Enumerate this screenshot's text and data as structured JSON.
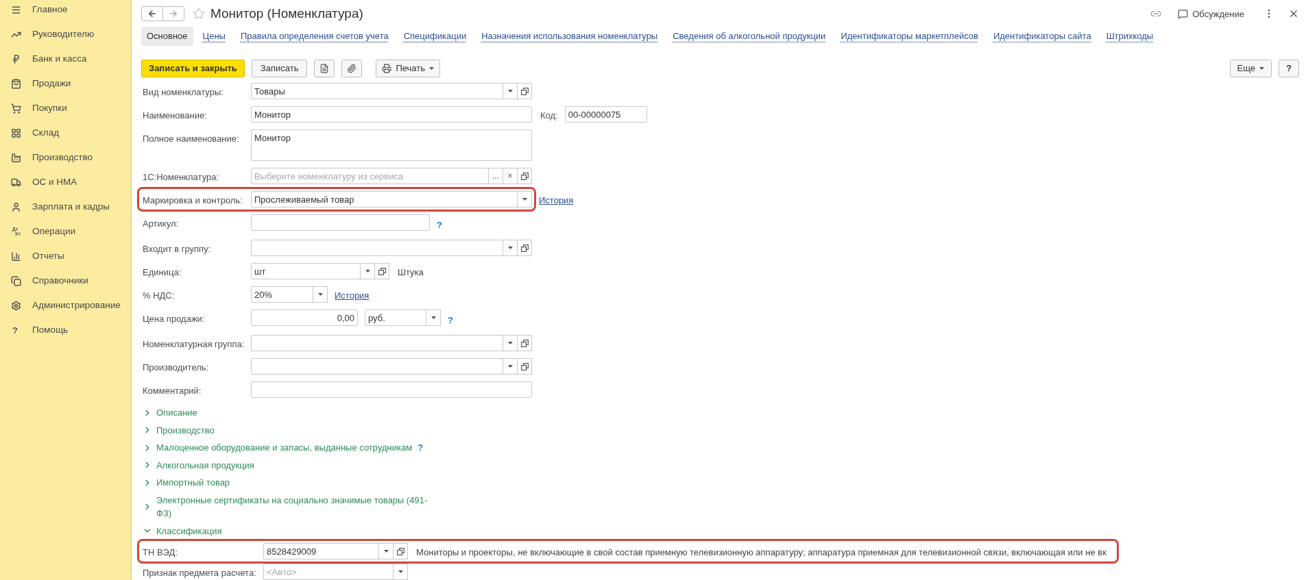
{
  "sidebar": {
    "items": [
      {
        "label": "Главное",
        "kind": "menu"
      },
      {
        "label": "Руководителю",
        "kind": "trend"
      },
      {
        "label": "Банк и касса",
        "kind": "ruble"
      },
      {
        "label": "Продажи",
        "kind": "bag"
      },
      {
        "label": "Покупки",
        "kind": "cart"
      },
      {
        "label": "Склад",
        "kind": "grid"
      },
      {
        "label": "Производство",
        "kind": "factory"
      },
      {
        "label": "ОС и НМА",
        "kind": "truck"
      },
      {
        "label": "Зарплата и кадры",
        "kind": "user"
      },
      {
        "label": "Операции",
        "kind": "glyph",
        "icon_text": [
          "Дт",
          "Кт"
        ]
      },
      {
        "label": "Отчеты",
        "kind": "chart"
      },
      {
        "label": "Справочники",
        "kind": "books"
      },
      {
        "label": "Администрирование",
        "kind": "gear"
      },
      {
        "label": "Помощь",
        "kind": "glyph",
        "icon_text": [
          "?"
        ]
      }
    ]
  },
  "header": {
    "title": "Монитор (Номенклатура)",
    "discussion": "Обсуждение"
  },
  "tabs": [
    {
      "label": "Основное",
      "selected": true
    },
    {
      "label": "Цены",
      "selected": false
    },
    {
      "label": "Правила определения счетов учета",
      "selected": false
    },
    {
      "label": "Спецификации",
      "selected": false
    },
    {
      "label": "Назначения использования номенклатуры",
      "selected": false
    },
    {
      "label": "Сведения об алкогольной продукции",
      "selected": false
    },
    {
      "label": "Идентификаторы маркетплейсов",
      "selected": false
    },
    {
      "label": "Идентификаторы сайта",
      "selected": false
    },
    {
      "label": "Штрихкоды",
      "selected": false
    }
  ],
  "toolbar": {
    "save_close": "Записать и закрыть",
    "save": "Записать",
    "print": "Печать",
    "more": "Еще",
    "help": "?"
  },
  "form": {
    "fields": [
      {
        "label": "Вид номенклатуры:",
        "value": "Товары",
        "buttons": [
          {
            "kind": "dropdown"
          },
          {
            "kind": "open"
          }
        ]
      },
      {
        "label": "Наименование:",
        "value": "Монитор",
        "extra": {
          "label": "Код:",
          "value": "00-00000075"
        }
      },
      {
        "label": "Полное наименование:",
        "kind": "multiline",
        "value": "Монитор"
      },
      {
        "label": "1С:Номенклатура:",
        "placeholder": "Выберите номенклатуру из сервиса",
        "buttons": [
          {
            "kind": "text",
            "text": "..."
          },
          {
            "kind": "text",
            "text": "×"
          },
          {
            "kind": "open"
          }
        ]
      },
      {
        "label": "Маркировка и контроль:",
        "value": "Прослеживаемый товар",
        "highlighted": true,
        "buttons": [
          {
            "kind": "dropdown"
          }
        ],
        "link": "История"
      },
      {
        "label": "Артикул:",
        "help": "?"
      },
      {
        "label": "Входит в группу:",
        "buttons": [
          {
            "kind": "dropdown"
          },
          {
            "kind": "open"
          }
        ]
      },
      {
        "label": "Единица:",
        "value": "шт",
        "buttons": [
          {
            "kind": "dropdown"
          },
          {
            "kind": "open"
          }
        ],
        "note": "Штука"
      },
      {
        "label": "% НДС:",
        "value": "20%",
        "buttons": [
          {
            "kind": "dropdown"
          }
        ],
        "link": "История"
      },
      {
        "label": "Цена продажи:",
        "kind": "number",
        "value": "0,00",
        "second": {
          "value": "руб.",
          "buttons": [
            {
              "kind": "dropdown"
            }
          ]
        },
        "help": "?"
      },
      {
        "label": "Номенклатурная группа:",
        "buttons": [
          {
            "kind": "dropdown"
          },
          {
            "kind": "open"
          }
        ]
      },
      {
        "label": "Производитель:",
        "buttons": [
          {
            "kind": "dropdown"
          },
          {
            "kind": "open"
          }
        ]
      },
      {
        "label": "Комментарий:"
      }
    ],
    "groups": [
      {
        "title": "Описание",
        "expanded": false
      },
      {
        "title": "Производство",
        "expanded": false
      },
      {
        "title": "Малоценное оборудование и запасы, выданные сотрудникам",
        "expanded": false,
        "help": "?"
      },
      {
        "title": "Алкогольная продукция",
        "expanded": false
      },
      {
        "title": "Импортный товар",
        "expanded": false
      },
      {
        "title": "Электронные сертификаты на социально значимые товары (491-ФЗ)",
        "expanded": false
      },
      {
        "title": "Классификация",
        "expanded": true,
        "fields": [
          {
            "label": "ТН ВЭД:",
            "value": "8528429009",
            "highlighted": true,
            "buttons": [
              {
                "kind": "dropdown"
              },
              {
                "kind": "open"
              }
            ],
            "note": "Мониторы и проекторы, не включающие в свой состав приемную телевизионную аппаратуру; аппаратура приемная для телевизионной связи, включающая или не вк"
          },
          {
            "label": "Признак предмета расчета:",
            "placeholder": "<Авто>",
            "buttons": [
              {
                "kind": "dropdown"
              }
            ]
          }
        ]
      }
    ]
  }
}
